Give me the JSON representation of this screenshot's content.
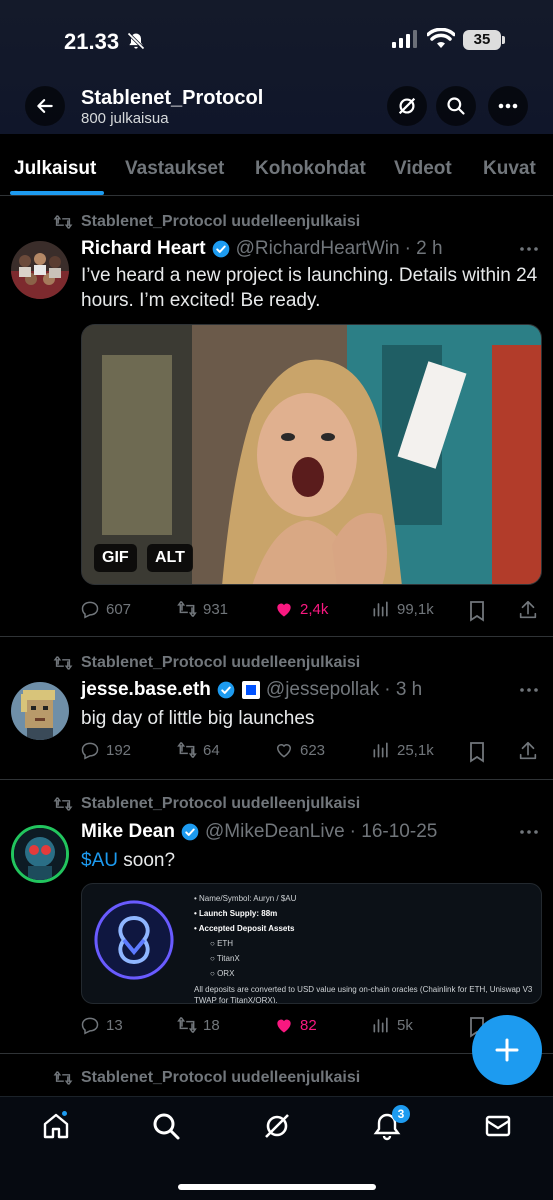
{
  "status_bar": {
    "time": "21.33",
    "battery": "35"
  },
  "header": {
    "title": "Stablenet_Protocol",
    "subtitle": "800 julkaisua"
  },
  "tabs": [
    "Julkaisut",
    "Vastaukset",
    "Kohokohdat",
    "Videot",
    "Kuvat"
  ],
  "posts": [
    {
      "repost_label": "Stablenet_Protocol uudelleenjulkaisi",
      "name": "Richard Heart",
      "handle": "@RichardHeartWin",
      "time": "· 2 h",
      "text": "I’ve heard a new project is launching. Details within 24 hours. I’m excited! Be ready.",
      "media_badges": [
        "GIF",
        "ALT"
      ],
      "replies": "607",
      "reposts": "931",
      "likes": "2,4k",
      "views": "99,1k",
      "liked": true
    },
    {
      "repost_label": "Stablenet_Protocol uudelleenjulkaisi",
      "name": "jesse.base.eth",
      "handle": "@jessepollak",
      "time": "· 3 h",
      "text": "big day of little big launches",
      "replies": "192",
      "reposts": "64",
      "likes": "623",
      "views": "25,1k",
      "liked": false
    },
    {
      "repost_label": "Stablenet_Protocol uudelleenjulkaisi",
      "name": "Mike Dean",
      "handle": "@MikeDeanLive",
      "time": "· 16-10-25",
      "cashtag": "$AU",
      "text_rest": " soon?",
      "card": {
        "items": [
          "Name/Symbol: Auryn / $AU",
          "Launch Supply: 88m",
          "Accepted Deposit Assets"
        ],
        "sub_items": [
          "ETH",
          "TitanX",
          "ORX"
        ],
        "footer": "All deposits are converted to USD value using on-chain oracles (Chainlink for ETH, Uniswap V3 TWAP for TitanX/ORX)."
      },
      "replies": "13",
      "reposts": "18",
      "likes": "82",
      "views": "5k",
      "liked": true
    },
    {
      "repost_label": "Stablenet_Protocol uudelleenjulkaisi"
    }
  ],
  "bottom_nav": {
    "notification_count": "3"
  },
  "colors": {
    "accent": "#1d9bf0",
    "like": "#f91880",
    "muted": "#71767b"
  }
}
